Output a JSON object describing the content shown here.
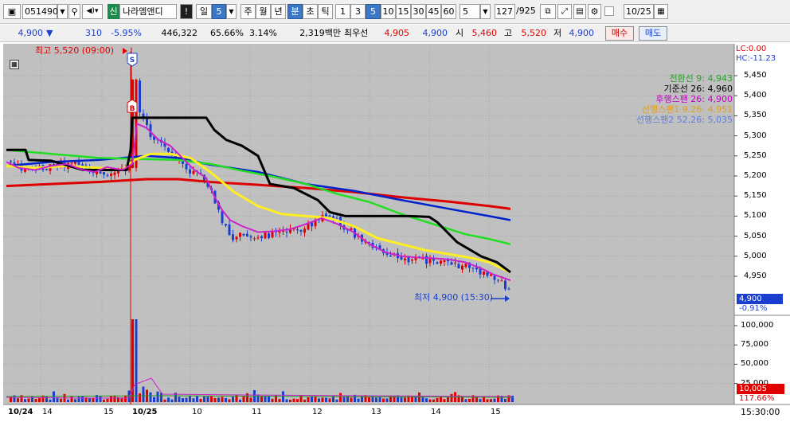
{
  "toolbar": {
    "code": "051490",
    "credit_badge": "신",
    "stock_name": "나라엠앤디",
    "exclaim": "!",
    "period_day": "일",
    "period_value": "5",
    "week": "주",
    "month": "월",
    "year": "년",
    "minute": "분",
    "second": "초",
    "tick": "틱",
    "intervals": [
      "1",
      "3",
      "5",
      "10",
      "15",
      "30",
      "45",
      "60"
    ],
    "selected_interval": "5",
    "count": "5",
    "position": "127",
    "total": "/925",
    "date": "10/25"
  },
  "infobar": {
    "price": "4,900",
    "change_arrow": "▼",
    "change": "310",
    "change_pct": "-5.95%",
    "volume": "446,322",
    "vol_ratio": "65.66%",
    "turnover": "3.14%",
    "amount": "2,319백만",
    "ask_label": "최우선",
    "ask": "4,905",
    "bid": "4,900",
    "open_label": "시",
    "open": "5,460",
    "high_label": "고",
    "high": "5,520",
    "low_label": "저",
    "low": "4,900",
    "buy_button": "매수",
    "sell_button": "매도"
  },
  "annotations": {
    "high": "최고 5,520 (09:00)",
    "low": "최저 4,900 (15:30)",
    "lc": "LC:0.00",
    "hc": "HC:-11.23",
    "marker_s": "S",
    "marker_b": "B"
  },
  "legend": [
    {
      "label": "전환선 9: 4,943",
      "color": "#2aa02a"
    },
    {
      "label": "기준선 26: 4,960",
      "color": "#000000"
    },
    {
      "label": "후행스팬 26: 4,900",
      "color": "#c000c0"
    },
    {
      "label": "선행스팬1 9,26: 4,951",
      "color": "#e0a020"
    },
    {
      "label": "선행스팬2 52,26: 5,035",
      "color": "#5a7fe0"
    }
  ],
  "price_axis": [
    "5,450",
    "5,400",
    "5,350",
    "5,300",
    "5,250",
    "5,200",
    "5,150",
    "5,100",
    "5,050",
    "5,000",
    "4,950"
  ],
  "price_tag": {
    "value": "4,900",
    "pct": "-0.91%"
  },
  "volume_axis": [
    "100,000",
    "75,000",
    "50,000",
    "25,000"
  ],
  "volume_tag": {
    "value": "10,005",
    "pct": "117.66%"
  },
  "time_axis": [
    "10/24",
    "14",
    "15",
    "10/25",
    "10",
    "11",
    "12",
    "13",
    "14",
    "15"
  ],
  "time_readout": "15:30:00",
  "colors": {
    "up": "#e00000",
    "down": "#1a3fcf",
    "chart_bg": "#c0c0c0"
  }
}
